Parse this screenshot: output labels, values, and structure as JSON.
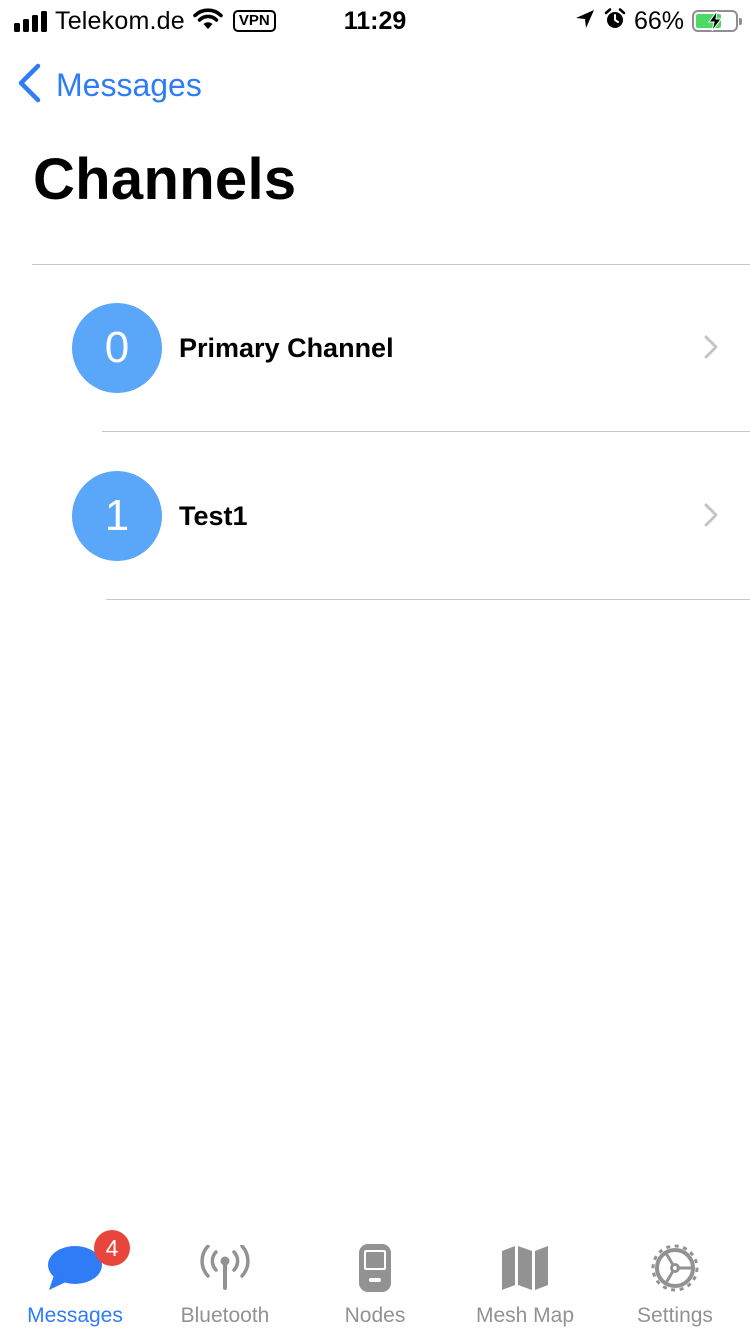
{
  "status_bar": {
    "carrier": "Telekom.de",
    "vpn": "VPN",
    "time": "11:29",
    "battery_percent": "66%",
    "battery_level": 0.66,
    "icons": [
      "signal-bars-icon",
      "wifi-icon",
      "location-arrow-icon",
      "alarm-icon",
      "battery-icon",
      "charging-bolt-icon"
    ]
  },
  "nav": {
    "back_label": "Messages",
    "title": "Channels"
  },
  "channels": [
    {
      "index": "0",
      "name": "Primary Channel"
    },
    {
      "index": "1",
      "name": "Test1"
    }
  ],
  "tab_bar": {
    "items": [
      {
        "label": "Messages",
        "icon": "chat-bubble-icon",
        "active": true,
        "badge": "4"
      },
      {
        "label": "Bluetooth",
        "icon": "antenna-icon",
        "active": false
      },
      {
        "label": "Nodes",
        "icon": "handheld-device-icon",
        "active": false
      },
      {
        "label": "Mesh Map",
        "icon": "map-icon",
        "active": false
      },
      {
        "label": "Settings",
        "icon": "gear-icon",
        "active": false
      }
    ]
  },
  "colors": {
    "accent": "#2f7cf6",
    "avatar": "#5aa6f9",
    "badge": "#e8453c",
    "inactive_tab": "#929292",
    "battery_fill": "#4cd964"
  }
}
